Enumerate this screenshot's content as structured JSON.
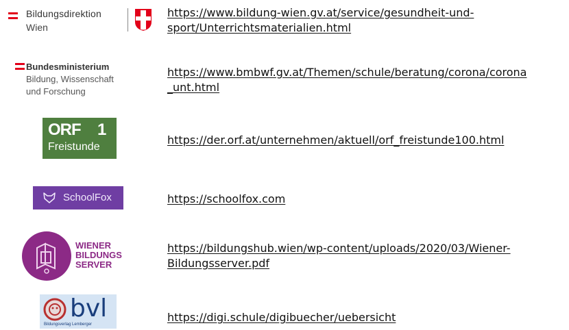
{
  "resources": [
    {
      "logo": {
        "title": "Bildungsdirektion",
        "subtitle": "Wien",
        "icon": "vienna-shield-icon"
      },
      "link_lines": [
        "https://www.bildung-wien.gv.at/service/gesundheit-und-",
        "sport/Unterrichtsmaterialien.html"
      ]
    },
    {
      "logo": {
        "title": "Bundesministerium",
        "line1": "Bildung, Wissenschaft",
        "line2": "und Forschung"
      },
      "link_lines": [
        "https://www.bmbwf.gv.at/Themen/schule/beratung/corona/corona",
        "_unt.html"
      ]
    },
    {
      "logo": {
        "title": "ORF",
        "number": "1",
        "subtitle": "Freistunde"
      },
      "link_lines": [
        "https://der.orf.at/unternehmen/aktuell/orf_freistunde100.html"
      ]
    },
    {
      "logo": {
        "title": "SchoolFox",
        "icon": "fox-icon"
      },
      "link_lines": [
        "https://schoolfox.com"
      ]
    },
    {
      "logo": {
        "line1": "WIENER",
        "line2": "BILDUNGS",
        "line3": "SERVER"
      },
      "link_lines": [
        "https://bildungshub.wien/wp-content/uploads/2020/03/Wiener-",
        "Bildungsserver.pdf"
      ]
    },
    {
      "logo": {
        "title": "bvl",
        "subtitle": "Bildungsverlag Lemberger"
      },
      "link_lines": [
        "https://digi.schule/digibuecher/uebersicht"
      ]
    }
  ],
  "colors": {
    "austria_red": "#e2001a",
    "orf_green": "#4f7f3f",
    "schoolfox_purple": "#6f3ea3",
    "wbs_purple": "#8c2a86",
    "bvl_blue": "#1a3e7c"
  }
}
